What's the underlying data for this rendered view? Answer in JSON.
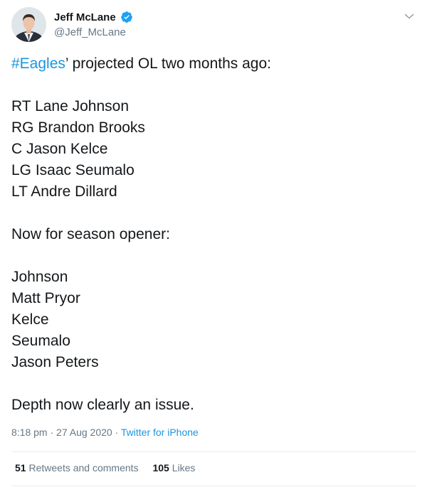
{
  "author": {
    "display_name": "Jeff McLane",
    "handle": "@Jeff_McLane",
    "verified_icon": "verified-badge-icon",
    "avatar_icon": "avatar-photo"
  },
  "menu_icon": "chevron-down-icon",
  "tweet": {
    "hashtag": "#Eagles",
    "first_line_rest": "’ projected OL two months ago:",
    "lines": [
      "RT Lane Johnson",
      "RG Brandon Brooks",
      "C Jason Kelce",
      "LG Isaac Seumalo",
      "LT Andre Dillard"
    ],
    "section_two_title": "Now for season opener:",
    "lines_two": [
      "Johnson",
      "Matt Pryor",
      "Kelce",
      "Seumalo",
      "Jason Peters"
    ],
    "closing": "Depth now clearly an issue."
  },
  "meta": {
    "time": "8:18 pm",
    "separator": "·",
    "date": "27 Aug 2020",
    "source": "Twitter for iPhone"
  },
  "stats": {
    "retweets_count": "51",
    "retweets_label": "Retweets and comments",
    "likes_count": "105",
    "likes_label": "Likes"
  },
  "colors": {
    "link": "#1b95e0",
    "secondary_text": "#657786",
    "primary_text": "#14171a",
    "divider": "#e6ecf0"
  }
}
